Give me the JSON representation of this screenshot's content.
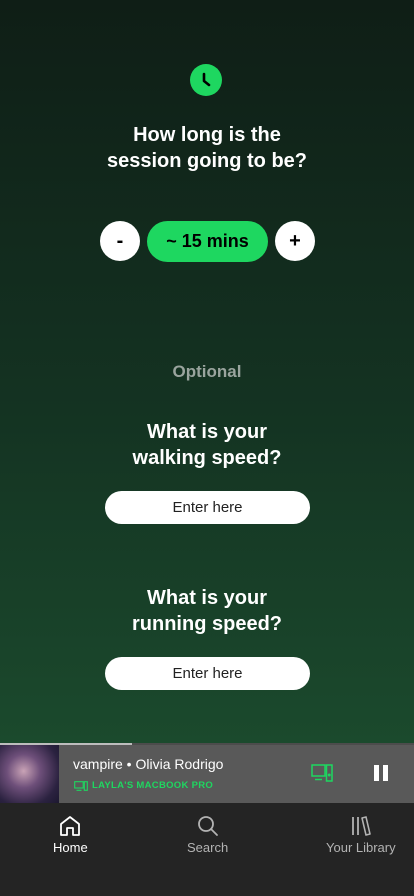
{
  "session": {
    "question": "How long is the\nsession going to be?",
    "decrement_label": "-",
    "duration": "~ 15 mins",
    "increment_label": "+"
  },
  "optional_label": "Optional",
  "walking": {
    "question": "What is your\nwalking speed?",
    "placeholder": "Enter here"
  },
  "running": {
    "question": "What is your\nrunning speed?",
    "placeholder": "Enter here"
  },
  "now_playing": {
    "track": "vampire",
    "separator": " • ",
    "artist": "Olivia Rodrigo",
    "device": "LAYLA'S MACBOOK PRO",
    "progress_fraction": 0.32,
    "accent": "#1ed760"
  },
  "nav": {
    "items": [
      {
        "label": "Home",
        "icon": "home-icon",
        "active": true
      },
      {
        "label": "Search",
        "icon": "search-icon",
        "active": false
      },
      {
        "label": "Your Library",
        "icon": "library-icon",
        "active": false
      }
    ]
  }
}
